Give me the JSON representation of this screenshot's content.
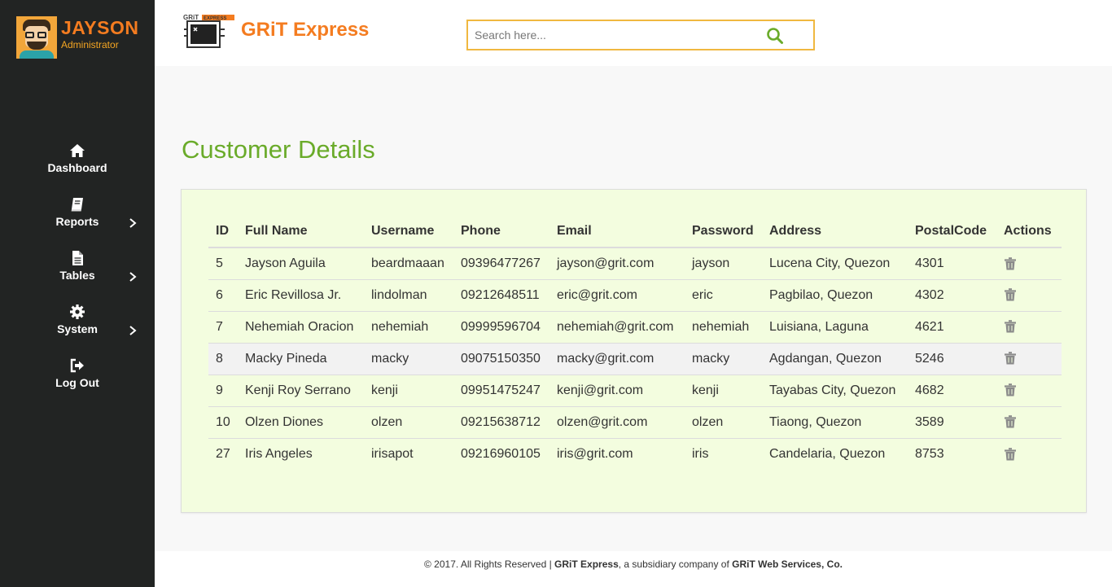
{
  "profile": {
    "name": "JAYSON",
    "role": "Administrator"
  },
  "nav": {
    "items": [
      {
        "label": "Dashboard",
        "icon": "home-icon",
        "has_submenu": false
      },
      {
        "label": "Reports",
        "icon": "book-icon",
        "has_submenu": true
      },
      {
        "label": "Tables",
        "icon": "file-icon",
        "has_submenu": true
      },
      {
        "label": "System",
        "icon": "gear-icon",
        "has_submenu": true
      },
      {
        "label": "Log Out",
        "icon": "sign-out-icon",
        "has_submenu": false
      }
    ]
  },
  "header": {
    "brand": "GRiT Express",
    "logo_text": "GRiT EXPRESS",
    "search_placeholder": "Search here..."
  },
  "main": {
    "title": "Customer Details",
    "table": {
      "columns": [
        "ID",
        "Full Name",
        "Username",
        "Phone",
        "Email",
        "Password",
        "Address",
        "PostalCode",
        "Actions"
      ],
      "rows": [
        [
          "5",
          "Jayson Aguila",
          "beardmaaan",
          "09396477267",
          "jayson@grit.com",
          "jayson",
          "Lucena City, Quezon",
          "4301"
        ],
        [
          "6",
          "Eric Revillosa Jr.",
          "lindolman",
          "09212648511",
          "eric@grit.com",
          "eric",
          "Pagbilao, Quezon",
          "4302"
        ],
        [
          "7",
          "Nehemiah Oracion",
          "nehemiah",
          "09999596704",
          "nehemiah@grit.com",
          "nehemiah",
          "Luisiana, Laguna",
          "4621"
        ],
        [
          "8",
          "Macky Pineda",
          "macky",
          "09075150350",
          "macky@grit.com",
          "macky",
          "Agdangan, Quezon",
          "5246"
        ],
        [
          "9",
          "Kenji Roy Serrano",
          "kenji",
          "09951475247",
          "kenji@grit.com",
          "kenji",
          "Tayabas City, Quezon",
          "4682"
        ],
        [
          "10",
          "Olzen Diones",
          "olzen",
          "09215638712",
          "olzen@grit.com",
          "olzen",
          "Tiaong, Quezon",
          "3589"
        ],
        [
          "27",
          "Iris Angeles",
          "irisapot",
          "09216960105",
          "iris@grit.com",
          "iris",
          "Candelaria, Quezon",
          "8753"
        ]
      ],
      "highlighted_row": 3
    }
  },
  "footer": {
    "prefix": "© 2017. All Rights Reserved | ",
    "brand": "GRiT Express",
    "middle": ", a subsidiary company of ",
    "company": "GRiT Web Services, Co."
  },
  "colors": {
    "sidebar": "#222423",
    "accent_orange": "#f47c20",
    "title_green": "#6aab2a",
    "panel_bg": "#f3fddf",
    "search_border": "#f0b840"
  }
}
